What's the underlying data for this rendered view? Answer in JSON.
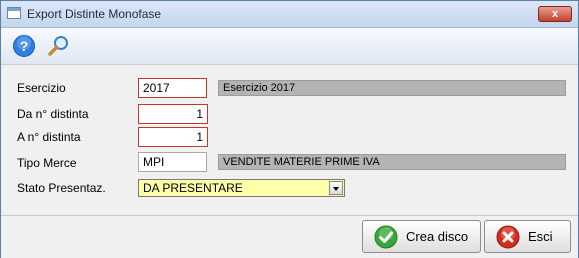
{
  "window": {
    "title": "Export Distinte Monofase",
    "close_label": "x"
  },
  "toolbar": {
    "help_icon": "help-icon",
    "search_icon": "search-icon"
  },
  "form": {
    "esercizio": {
      "label": "Esercizio",
      "value": "2017",
      "description": "Esercizio 2017"
    },
    "da_distinta": {
      "label": "Da n° distinta",
      "value": "1"
    },
    "a_distinta": {
      "label": "A n° distinta",
      "value": "1"
    },
    "tipo_merce": {
      "label": "Tipo Merce",
      "value": "MPI",
      "description": "VENDITE MATERIE PRIME IVA"
    },
    "stato": {
      "label": "Stato Presentaz.",
      "value": "DA PRESENTARE"
    }
  },
  "buttons": {
    "create_label": "Crea disco",
    "exit_label": "Esci"
  },
  "colors": {
    "required_border": "#c0392b",
    "select_bg": "#ffffa8",
    "desc_bg": "#b4b4b4",
    "ok_green": "#3aa63a",
    "exit_red": "#d42b1e"
  }
}
